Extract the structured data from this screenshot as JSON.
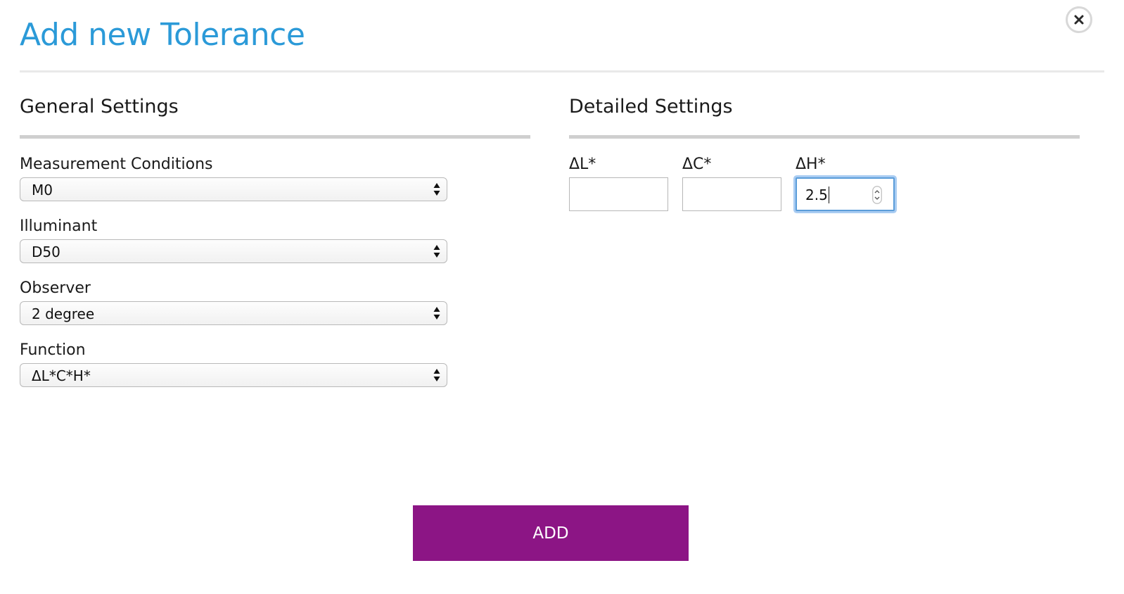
{
  "dialog": {
    "title": "Add new Tolerance"
  },
  "general": {
    "title": "General Settings",
    "fields": [
      {
        "label": "Measurement Conditions",
        "value": "M0"
      },
      {
        "label": "Illuminant",
        "value": "D50"
      },
      {
        "label": "Observer",
        "value": "2 degree"
      },
      {
        "label": "Function",
        "value": "ΔL*C*H*"
      }
    ]
  },
  "detailed": {
    "title": "Detailed Settings",
    "inputs": [
      {
        "label": "ΔL*",
        "value": ""
      },
      {
        "label": "ΔC*",
        "value": ""
      },
      {
        "label": "ΔH*",
        "value": "2.5"
      }
    ]
  },
  "actions": {
    "add_label": "ADD"
  },
  "icons": {
    "close": "close-icon",
    "select_arrows": "select-arrows-icon",
    "spinner": "spinner-icon"
  },
  "colors": {
    "title": "#2b9ad8",
    "add_button": "#8c1585",
    "focus_ring": "#5b9dd9"
  }
}
